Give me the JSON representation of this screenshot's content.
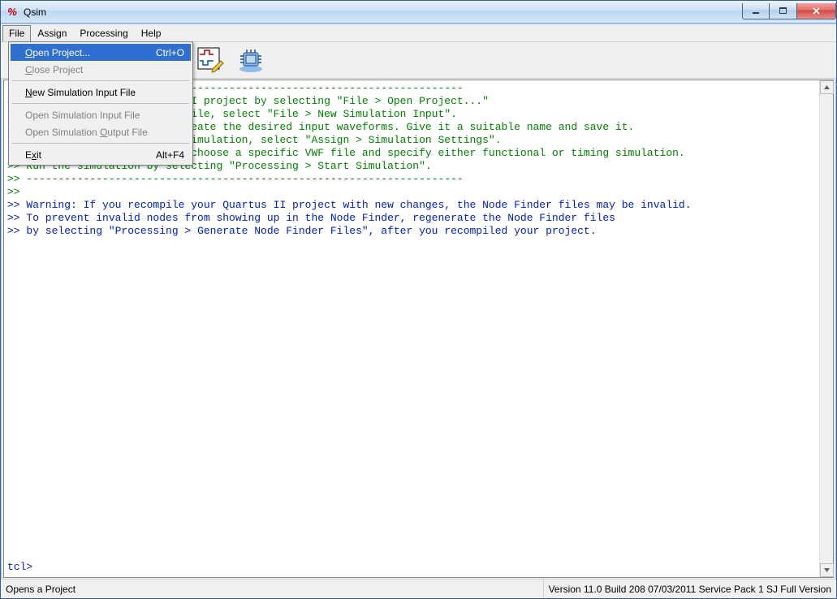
{
  "window": {
    "title": "Qsim"
  },
  "menubar": {
    "file": "File",
    "assign": "Assign",
    "processing": "Processing",
    "help": "Help"
  },
  "file_menu": {
    "open_project": "Open Project...",
    "open_project_shortcut": "Ctrl+O",
    "close_project": "Close Project",
    "new_sim_input": "New Simulation Input File",
    "open_sim_input": "Open Simulation Input File",
    "open_sim_output": "Open Simulation Output File",
    "exit": "Exit",
    "exit_shortcut": "Alt+F4"
  },
  "console": {
    "l1": ">> ---------------------------------------------------------------------",
    "l2": ">> Open an existing Quartus II project by selecting \"File > Open Project...\"",
    "l3": ">> To create a new waveform file, select \"File > New Simulation Input\".",
    "l4": ">> In the Waveform Editor, create the desired input waveforms. Give it a suitable name and save it.",
    "l5": ">> To specify a setting for simulation, select \"Assign > Simulation Settings\".",
    "l6": ">> In the pop-up dialog box, choose a specific VWF file and specify either functional or timing simulation.",
    "l7": ">> Run the simulation by selecting \"Processing > Start Simulation\".",
    "l8": ">> ---------------------------------------------------------------------",
    "l9": ">>",
    "l10": ">> Warning: If you recompile your Quartus II project with new changes, the Node Finder files may be invalid.",
    "l11": ">> To prevent invalid nodes from showing up in the Node Finder, regenerate the Node Finder files",
    "l12": ">> by selecting \"Processing > Generate Node Finder Files\", after you recompiled your project.",
    "prompt": "tcl>"
  },
  "status": {
    "left": "Opens a Project",
    "right": "Version 11.0 Build 208 07/03/2011 Service Pack 1 SJ Full Version"
  }
}
